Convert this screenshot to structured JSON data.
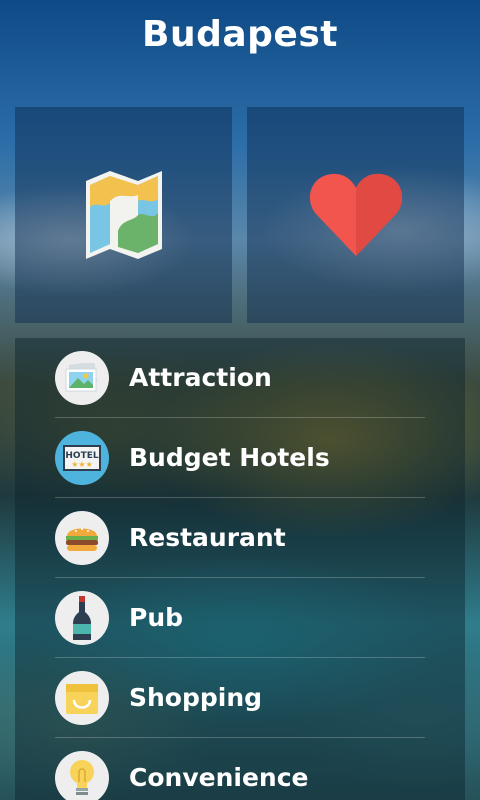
{
  "header": {
    "title": "Budapest"
  },
  "tiles": [
    {
      "name": "map",
      "icon": "map-icon"
    },
    {
      "name": "favorites",
      "icon": "heart-icon"
    }
  ],
  "menu": {
    "items": [
      {
        "label": "Attraction",
        "icon": "picture-icon"
      },
      {
        "label": "Budget Hotels",
        "icon": "hotel-sign-icon",
        "icon_text": "HOTEL"
      },
      {
        "label": "Restaurant",
        "icon": "burger-icon"
      },
      {
        "label": "Pub",
        "icon": "wine-bottle-icon"
      },
      {
        "label": "Shopping",
        "icon": "shopping-bag-icon"
      },
      {
        "label": "Convenience",
        "icon": "lightbulb-icon"
      }
    ]
  },
  "colors": {
    "heart": "#f2554e",
    "hotel_circle": "#4fb4dd",
    "icon_circle": "#eeeeee"
  }
}
